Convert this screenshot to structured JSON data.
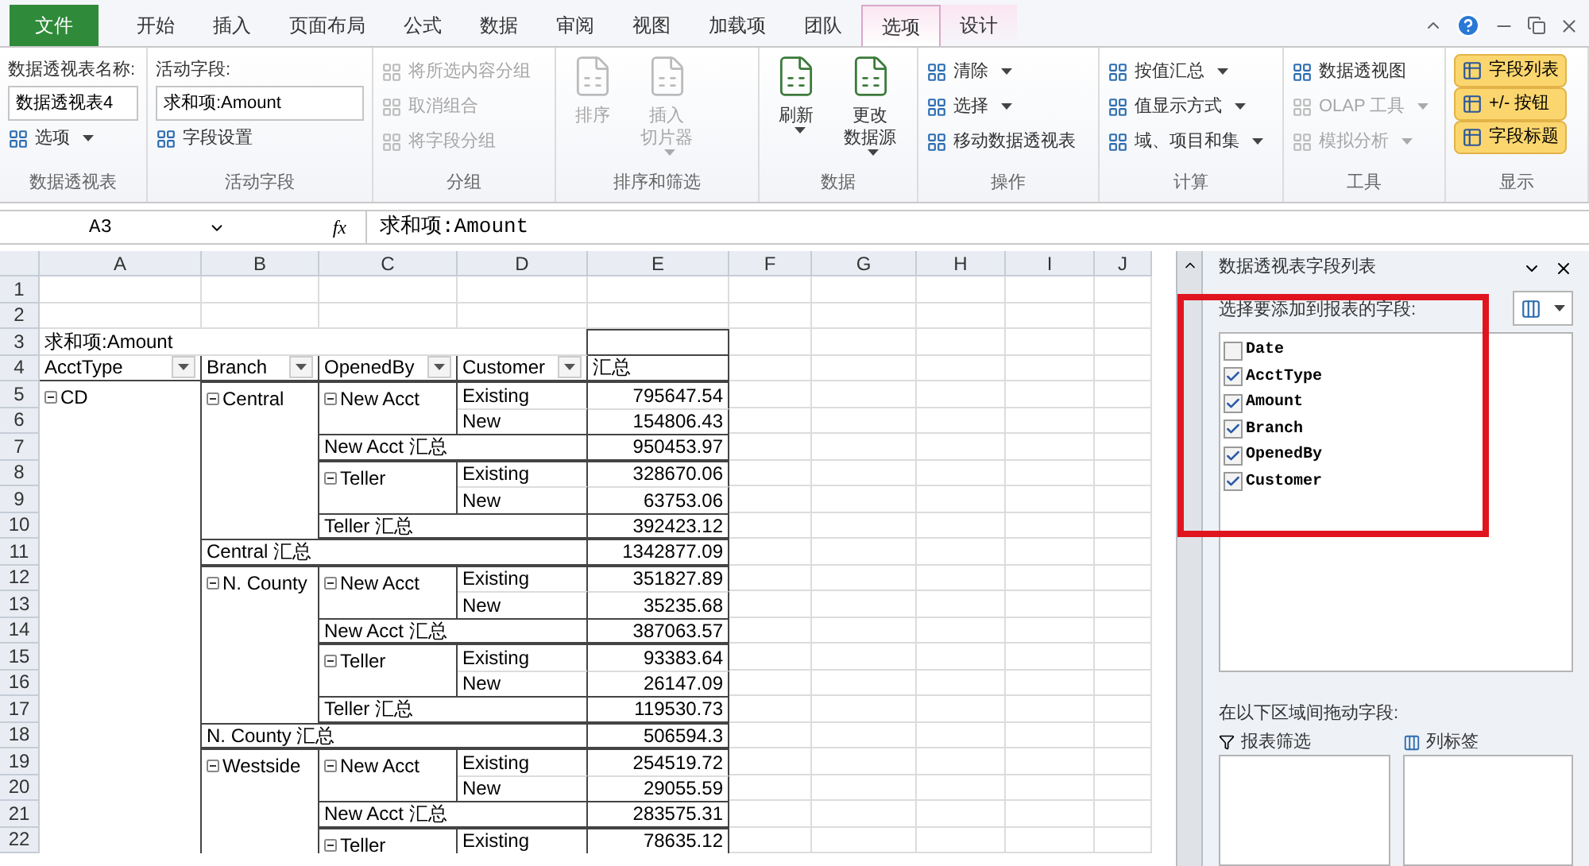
{
  "tabs": [
    {
      "label": "文件",
      "kind": "file",
      "selected": false
    },
    {
      "label": "开始",
      "kind": "normal",
      "selected": false
    },
    {
      "label": "插入",
      "kind": "normal",
      "selected": false
    },
    {
      "label": "页面布局",
      "kind": "normal",
      "selected": false
    },
    {
      "label": "公式",
      "kind": "normal",
      "selected": false
    },
    {
      "label": "数据",
      "kind": "normal",
      "selected": false
    },
    {
      "label": "审阅",
      "kind": "normal",
      "selected": false
    },
    {
      "label": "视图",
      "kind": "normal",
      "selected": false
    },
    {
      "label": "加载项",
      "kind": "normal",
      "selected": false
    },
    {
      "label": "团队",
      "kind": "normal",
      "selected": false
    },
    {
      "label": "选项",
      "kind": "contextual",
      "selected": true
    },
    {
      "label": "设计",
      "kind": "contextual",
      "selected": false
    }
  ],
  "ribbon": {
    "groups": [
      {
        "caption": "数据透视表",
        "items": [
          {
            "kind": "caption",
            "label": "数据透视表名称:"
          },
          {
            "kind": "field",
            "value": "数据透视表4"
          },
          {
            "kind": "small",
            "label": "选项",
            "disabled": false,
            "dropdown": true
          }
        ]
      },
      {
        "caption": "活动字段",
        "items": [
          {
            "kind": "caption",
            "label": "活动字段:"
          },
          {
            "kind": "field",
            "value": "求和项:Amount"
          },
          {
            "kind": "small",
            "label": "字段设置",
            "disabled": false,
            "dropdown": false
          }
        ]
      },
      {
        "caption": "分组",
        "items": [
          {
            "kind": "small",
            "label": "将所选内容分组",
            "disabled": true,
            "dropdown": false
          },
          {
            "kind": "small",
            "label": "取消组合",
            "disabled": true,
            "dropdown": false
          },
          {
            "kind": "small",
            "label": "将字段分组",
            "disabled": true,
            "dropdown": false
          }
        ]
      },
      {
        "caption": "排序和筛选",
        "items": [
          {
            "kind": "large",
            "lines": [
              "排序"
            ],
            "disabled": true,
            "dropdown": false
          },
          {
            "kind": "large",
            "lines": [
              "插入",
              "切片器"
            ],
            "disabled": true,
            "dropdown": true
          }
        ]
      },
      {
        "caption": "数据",
        "items": [
          {
            "kind": "large",
            "lines": [
              "刷新"
            ],
            "disabled": false,
            "dropdown": true
          },
          {
            "kind": "large",
            "lines": [
              "更改",
              "数据源"
            ],
            "disabled": false,
            "dropdown": true
          }
        ]
      },
      {
        "caption": "操作",
        "items": [
          {
            "kind": "small",
            "label": "清除",
            "disabled": false,
            "dropdown": true
          },
          {
            "kind": "small",
            "label": "选择",
            "disabled": false,
            "dropdown": true
          },
          {
            "kind": "small",
            "label": "移动数据透视表",
            "disabled": false,
            "dropdown": false
          }
        ]
      },
      {
        "caption": "计算",
        "items": [
          {
            "kind": "small",
            "label": "按值汇总",
            "disabled": false,
            "dropdown": true
          },
          {
            "kind": "small",
            "label": "值显示方式",
            "disabled": false,
            "dropdown": true
          },
          {
            "kind": "small",
            "label": "域、项目和集",
            "disabled": false,
            "dropdown": true
          }
        ]
      },
      {
        "caption": "工具",
        "items": [
          {
            "kind": "small",
            "label": "数据透视图",
            "disabled": false,
            "dropdown": false
          },
          {
            "kind": "small",
            "label": "OLAP 工具",
            "disabled": true,
            "dropdown": true
          },
          {
            "kind": "small",
            "label": "模拟分析",
            "disabled": true,
            "dropdown": true
          }
        ]
      },
      {
        "caption": "显示",
        "items": [
          {
            "kind": "toggle",
            "label": "字段列表",
            "selected": true
          },
          {
            "kind": "toggle",
            "label": "+/- 按钮",
            "selected": true
          },
          {
            "kind": "toggle",
            "label": "字段标题",
            "selected": true
          }
        ]
      }
    ]
  },
  "formula_bar": {
    "name_box": "A3",
    "fx": "fx",
    "formula": "求和项:Amount"
  },
  "sheet": {
    "columns": [
      "A",
      "B",
      "C",
      "D",
      "E",
      "F",
      "G",
      "H",
      "I",
      "J"
    ],
    "rows": [
      {
        "num": "1",
        "kind": "blank"
      },
      {
        "num": "2",
        "kind": "blank"
      },
      {
        "num": "3",
        "kind": "title",
        "text": "求和项:Amount"
      },
      {
        "num": "4",
        "kind": "header",
        "headers": [
          "AcctType",
          "Branch",
          "OpenedBy",
          "Customer"
        ],
        "total": "汇总"
      },
      {
        "num": "5",
        "kind": "data",
        "acct": {
          "text": "CD",
          "expanded": true
        },
        "branch": {
          "text": "Central",
          "expanded": true
        },
        "opened": {
          "text": "New Acct",
          "expanded": true
        },
        "customer": "Existing",
        "value": "795647.54"
      },
      {
        "num": "6",
        "kind": "data",
        "customer": "New",
        "value": "154806.43"
      },
      {
        "num": "7",
        "kind": "subtotal_opened",
        "text": "New Acct 汇总",
        "value": "950453.97"
      },
      {
        "num": "8",
        "kind": "data",
        "opened": {
          "text": "Teller",
          "expanded": true
        },
        "customer": "Existing",
        "value": "328670.06"
      },
      {
        "num": "9",
        "kind": "data",
        "customer": "New",
        "value": "63753.06"
      },
      {
        "num": "10",
        "kind": "subtotal_opened",
        "text": "Teller 汇总",
        "value": "392423.12"
      },
      {
        "num": "11",
        "kind": "subtotal_branch",
        "text": "Central 汇总",
        "value": "1342877.09"
      },
      {
        "num": "12",
        "kind": "data",
        "branch": {
          "text": "N. County",
          "expanded": true
        },
        "opened": {
          "text": "New Acct",
          "expanded": true
        },
        "customer": "Existing",
        "value": "351827.89"
      },
      {
        "num": "13",
        "kind": "data",
        "customer": "New",
        "value": "35235.68"
      },
      {
        "num": "14",
        "kind": "subtotal_opened",
        "text": "New Acct 汇总",
        "value": "387063.57"
      },
      {
        "num": "15",
        "kind": "data",
        "opened": {
          "text": "Teller",
          "expanded": true
        },
        "customer": "Existing",
        "value": "93383.64"
      },
      {
        "num": "16",
        "kind": "data",
        "customer": "New",
        "value": "26147.09"
      },
      {
        "num": "17",
        "kind": "subtotal_opened",
        "text": "Teller 汇总",
        "value": "119530.73"
      },
      {
        "num": "18",
        "kind": "subtotal_branch",
        "text": "N. County 汇总",
        "value": "506594.3"
      },
      {
        "num": "19",
        "kind": "data",
        "branch": {
          "text": "Westside",
          "expanded": true
        },
        "opened": {
          "text": "New Acct",
          "expanded": true
        },
        "customer": "Existing",
        "value": "254519.72"
      },
      {
        "num": "20",
        "kind": "data",
        "customer": "New",
        "value": "29055.59"
      },
      {
        "num": "21",
        "kind": "subtotal_opened",
        "text": "New Acct 汇总",
        "value": "283575.31"
      },
      {
        "num": "22",
        "kind": "data",
        "opened": {
          "text": "Teller",
          "expanded": true
        },
        "customer": "Existing",
        "value": "78635.12"
      }
    ]
  },
  "field_list": {
    "title": "数据透视表字段列表",
    "prompt": "选择要添加到报表的字段:",
    "fields": [
      {
        "name": "Date",
        "checked": false
      },
      {
        "name": "AcctType",
        "checked": true
      },
      {
        "name": "Amount",
        "checked": true
      },
      {
        "name": "Branch",
        "checked": true
      },
      {
        "name": "OpenedBy",
        "checked": true
      },
      {
        "name": "Customer",
        "checked": true
      }
    ],
    "areas_prompt": "在以下区域间拖动字段:",
    "areas": [
      "报表筛选",
      "列标签"
    ]
  }
}
